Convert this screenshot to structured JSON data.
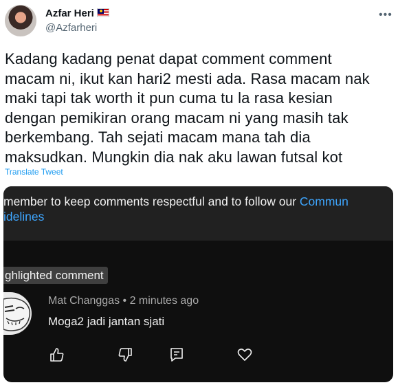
{
  "tweet": {
    "display_name": "Azfar Heri",
    "flag_emoji": "malaysia-flag-icon",
    "handle": "@Azfarheri",
    "text_lines": [
      "Kadang kadang penat dapat comment comment",
      "macam ni, ikut kan hari2 mesti ada. Rasa macam nak",
      "maki tapi tak worth it pun cuma tu la rasa kesian",
      "dengan pemikiran orang macam ni yang masih tak",
      "berkembang. Tah sejati macam mana tah dia",
      "maksudkan. Mungkin dia nak aku lawan futsal kot"
    ],
    "translate_label": "Translate Tweet"
  },
  "embed": {
    "reminder_line1": "member to keep comments respectful and to follow our ",
    "reminder_link1": "Commun",
    "reminder_line2_link": "idelines",
    "highlight_badge": "ghlighted comment",
    "comment": {
      "author": "Mat Changgas",
      "separator": "•",
      "time": "2 minutes ago",
      "text": "Moga2 jadi jantan sjati"
    },
    "action_icons": [
      "like-icon",
      "dislike-icon",
      "reply-icon",
      "heart-icon"
    ]
  },
  "colors": {
    "link_blue": "#1d9bf0",
    "yt_link": "#3ea6ff",
    "dark_bg": "#0f0f0f"
  }
}
